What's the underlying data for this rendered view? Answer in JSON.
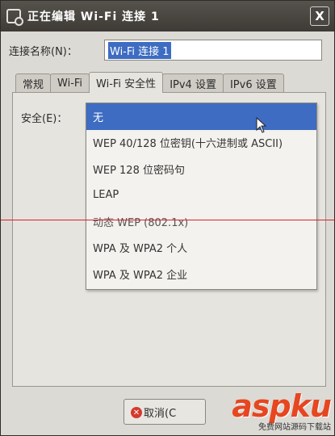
{
  "window": {
    "title": "正在编辑 Wi-Fi 连接 1",
    "close_glyph": "X"
  },
  "connection": {
    "label": "连接名称(N)：",
    "value": "Wi-Fi 连接 1"
  },
  "tabs": [
    {
      "label": "常规",
      "active": false
    },
    {
      "label": "Wi-Fi",
      "active": false
    },
    {
      "label": "Wi-Fi 安全性",
      "active": true
    },
    {
      "label": "IPv4 设置",
      "active": false
    },
    {
      "label": "IPv6 设置",
      "active": false
    }
  ],
  "security": {
    "label": "安全(E)：",
    "options": [
      {
        "label": "无",
        "selected": true
      },
      {
        "label": "WEP 40/128 位密钥(十六进制或 ASCII)",
        "selected": false
      },
      {
        "label": "WEP 128 位密码句",
        "selected": false
      },
      {
        "label": "LEAP",
        "selected": false
      },
      {
        "label": "动态 WEP (802.1x)",
        "selected": false
      },
      {
        "label": "WPA 及 WPA2 个人",
        "selected": false
      },
      {
        "label": "WPA 及 WPA2 企业",
        "selected": false
      }
    ]
  },
  "footer": {
    "cancel_label": "取消(C"
  },
  "watermark": {
    "brand": "aspku",
    "tagline": "免费网站源码下载站"
  },
  "colors": {
    "selection": "#3d6cc2",
    "titlebar": "#4a4640",
    "watermark": "#e64620"
  }
}
